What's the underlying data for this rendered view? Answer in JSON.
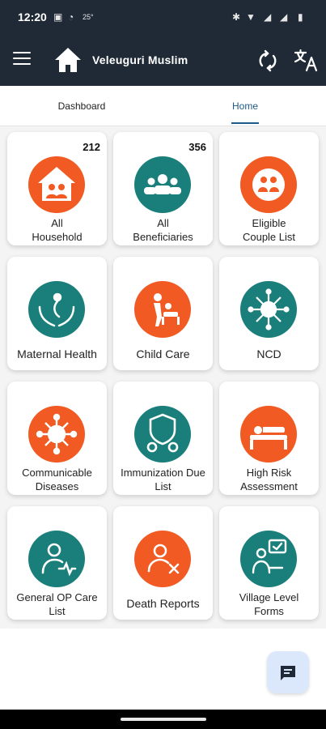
{
  "status_bar": {
    "time": "12:20",
    "icons": [
      "teams-icon",
      "messenger-icon",
      "temperature-icon",
      "bluetooth-icon",
      "wifi-icon",
      "mute-icon",
      "signal-icon",
      "battery-icon"
    ],
    "temp": "25°"
  },
  "app_bar": {
    "title": "Veleuguri Muslim",
    "menu_icon": "menu-icon",
    "home_icon": "home-icon",
    "sync_icon": "sync-icon",
    "translate_icon": "translate-icon"
  },
  "tabs": [
    {
      "label": "Dashboard",
      "active": false
    },
    {
      "label": "Home",
      "active": true
    }
  ],
  "cards": [
    {
      "label": "All\nHousehold",
      "count": "212",
      "color": "#f15a22",
      "icon": "household-icon"
    },
    {
      "label": "All\nBeneficiaries",
      "count": "356",
      "color": "#1a7f7b",
      "icon": "beneficiaries-icon"
    },
    {
      "label": "Eligible\nCouple List",
      "count": "",
      "color": "#f15a22",
      "icon": "couple-icon"
    },
    {
      "label": "Maternal Health",
      "count": "",
      "color": "#1a7f7b",
      "icon": "maternal-icon"
    },
    {
      "label": "Child Care",
      "count": "",
      "color": "#f15a22",
      "icon": "child-care-icon"
    },
    {
      "label": "NCD",
      "count": "",
      "color": "#1a7f7b",
      "icon": "ncd-icon"
    },
    {
      "label": "Communicable\nDiseases",
      "count": "",
      "color": "#f15a22",
      "icon": "virus-icon"
    },
    {
      "label": "Immunization Due\nList",
      "count": "",
      "color": "#1a7f7b",
      "icon": "immunization-icon"
    },
    {
      "label": "High Risk\nAssessment",
      "count": "",
      "color": "#f15a22",
      "icon": "high-risk-icon"
    },
    {
      "label": "General OP Care\nList",
      "count": "",
      "color": "#1a7f7b",
      "icon": "op-care-icon"
    },
    {
      "label": "Death Reports",
      "count": "",
      "color": "#f15a22",
      "icon": "death-report-icon"
    },
    {
      "label": "Village Level\nForms",
      "count": "",
      "color": "#1a7f7b",
      "icon": "village-forms-icon"
    }
  ],
  "fab": {
    "icon": "chat-icon"
  }
}
